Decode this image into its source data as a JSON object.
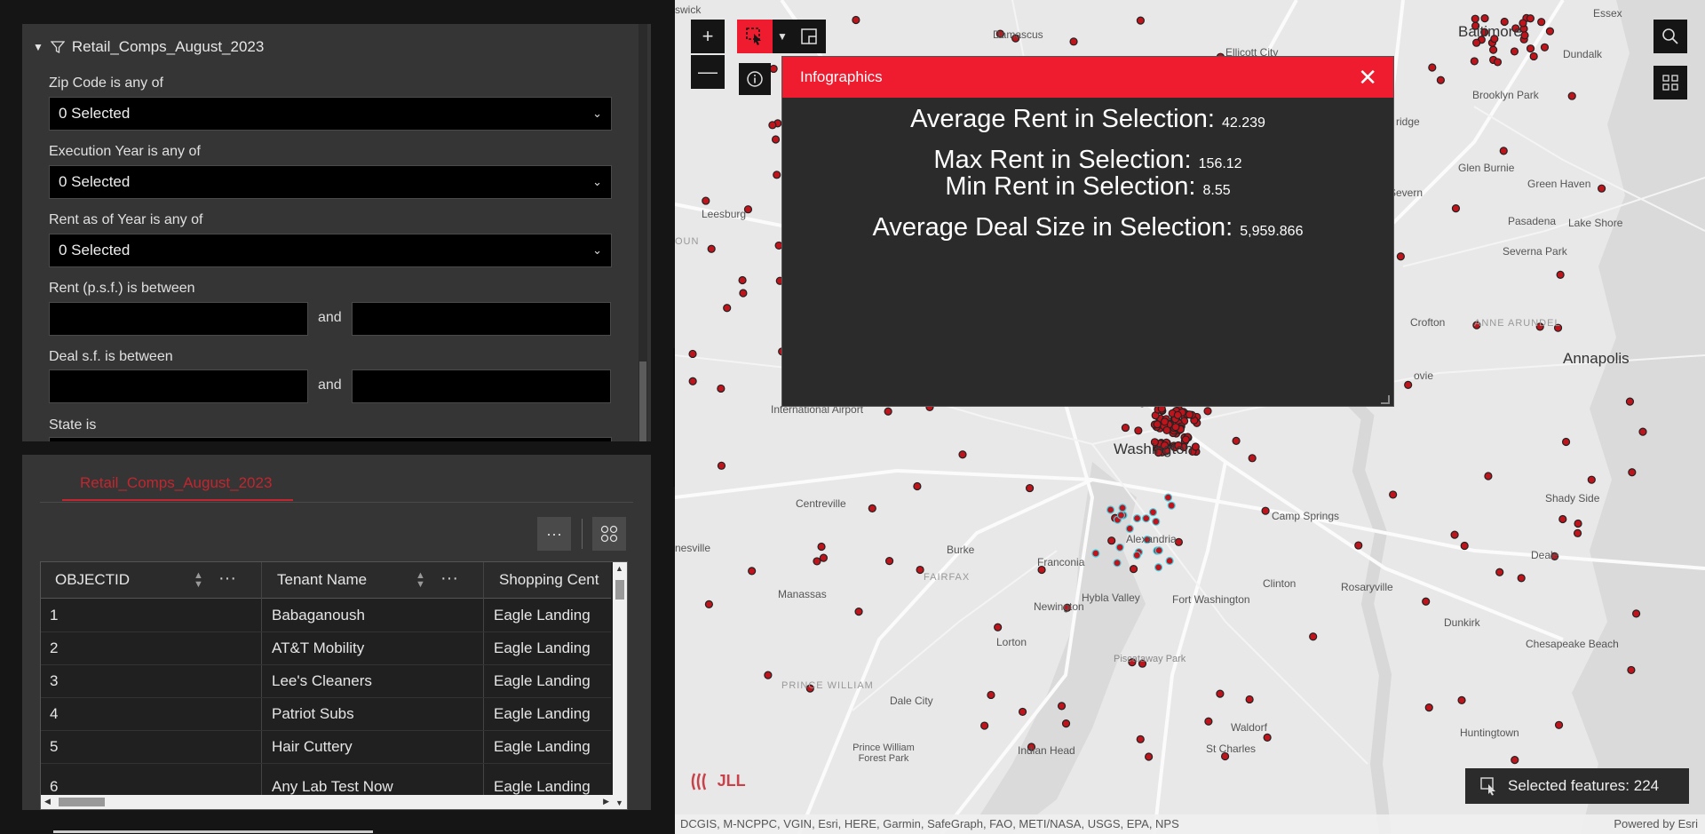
{
  "filter_panel": {
    "layer_name": "Retail_Comps_August_2023",
    "filters": [
      {
        "label": "Zip Code is any of",
        "value": "0 Selected"
      },
      {
        "label": "Execution Year is any of",
        "value": "0 Selected"
      },
      {
        "label": "Rent as of Year is any of",
        "value": "0 Selected"
      }
    ],
    "range_filters": [
      {
        "label": "Rent (p.s.f.) is between",
        "and": "and"
      },
      {
        "label": "Deal s.f. is between",
        "and": "and"
      }
    ],
    "state_label": "State is"
  },
  "table_panel": {
    "tab_label": "Retail_Comps_August_2023",
    "more_icon": "ellipsis-icon",
    "layout_icon": "grid-view-icon",
    "columns": [
      "OBJECTID",
      "Tenant Name",
      "Shopping Cent"
    ],
    "rows": [
      {
        "id": "1",
        "tenant": "Babaganoush",
        "center": "Eagle Landing"
      },
      {
        "id": "2",
        "tenant": "AT&T Mobility",
        "center": "Eagle Landing"
      },
      {
        "id": "3",
        "tenant": "Lee's Cleaners",
        "center": "Eagle Landing"
      },
      {
        "id": "4",
        "tenant": "Patriot Subs",
        "center": "Eagle Landing"
      },
      {
        "id": "5",
        "tenant": "Hair Cuttery",
        "center": "Eagle Landing"
      },
      {
        "id": "6",
        "tenant": "Any Lab Test Now",
        "center": "Eagle Landing"
      }
    ]
  },
  "map": {
    "places": [
      "Damascus",
      "Ellicott City",
      "Baltimore",
      "Dundalk",
      "Essex",
      "Brooklyn Park",
      "Glen Burnie",
      "Green Haven",
      "Pasadena",
      "Lake Shore",
      "Severn",
      "Severna Park",
      "Crofton",
      "ANNE ARUNDEL",
      "Annapolis",
      "Leesburg",
      "International Airport",
      "Washington",
      "Centreville",
      "Burke",
      "FAIRFAX",
      "Franconia",
      "Hybla Valley",
      "Fort Washington",
      "Camp Springs",
      "Clinton",
      "Rosaryville",
      "Shady Side",
      "Deale",
      "Dunkirk",
      "Chesapeake Beach",
      "Huntingtown",
      "Manassas",
      "Newington",
      "Lorton",
      "PRINCE WILLIAM",
      "Dale City",
      "Prince William Forest Park",
      "Piscataway Park",
      "Indian Head",
      "St Charles",
      "Waldorf",
      "Alexandria",
      "ridge",
      "ovie",
      "nesville",
      "OUN",
      "swick"
    ],
    "attribution": "DCGIS, M-NCPPC, VGIN, Esri, HERE, Garmin, SafeGraph, FAO, METI/NASA, USGS, EPA, NPS",
    "powered_by": "Powered by Esri",
    "selected_features": "Selected features: 224",
    "logo_text": "JLL",
    "accent_color": "#ee1c2e",
    "marker_color": "#c0141c",
    "selection_color": "#3fd0e0"
  },
  "infographics": {
    "title": "Infographics",
    "stats": [
      {
        "label": "Average Rent in Selection:",
        "value": "42.239"
      },
      {
        "label": "Max Rent in Selection:",
        "value": "156.12"
      },
      {
        "label": "Min Rent in Selection:",
        "value": "8.55"
      },
      {
        "label": "Average Deal Size in Selection:",
        "value": "5,959.866"
      }
    ]
  }
}
